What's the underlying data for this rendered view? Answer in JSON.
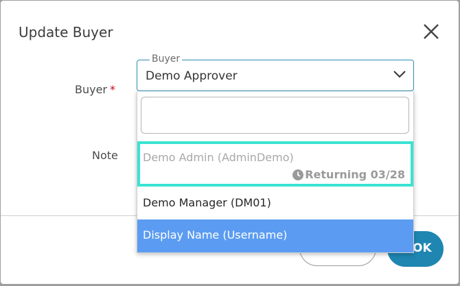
{
  "dialog": {
    "title": "Update Buyer",
    "close_icon": "close-icon"
  },
  "form": {
    "buyer_label": "Buyer",
    "required_marker": "*",
    "note_label": "Note"
  },
  "buyer_select": {
    "legend": "Buyer",
    "selected": "Demo Approver",
    "chevron_icon": "chevron-down-icon"
  },
  "dropdown": {
    "search_value": "",
    "options": [
      {
        "label": "Demo Admin (AdminDemo)",
        "status": "Returning 03/28",
        "status_icon": "clock-icon",
        "state": "disabled-focused"
      },
      {
        "label": "Demo Manager (DM01)",
        "state": "normal"
      },
      {
        "label": "Display Name (Username)",
        "state": "highlighted"
      }
    ]
  },
  "footer": {
    "ok_label": "OK"
  },
  "colors": {
    "accent": "#1f86b1",
    "focus_outline": "#3ae3d3",
    "highlight": "#5b9cf2",
    "required": "#d0021b"
  }
}
